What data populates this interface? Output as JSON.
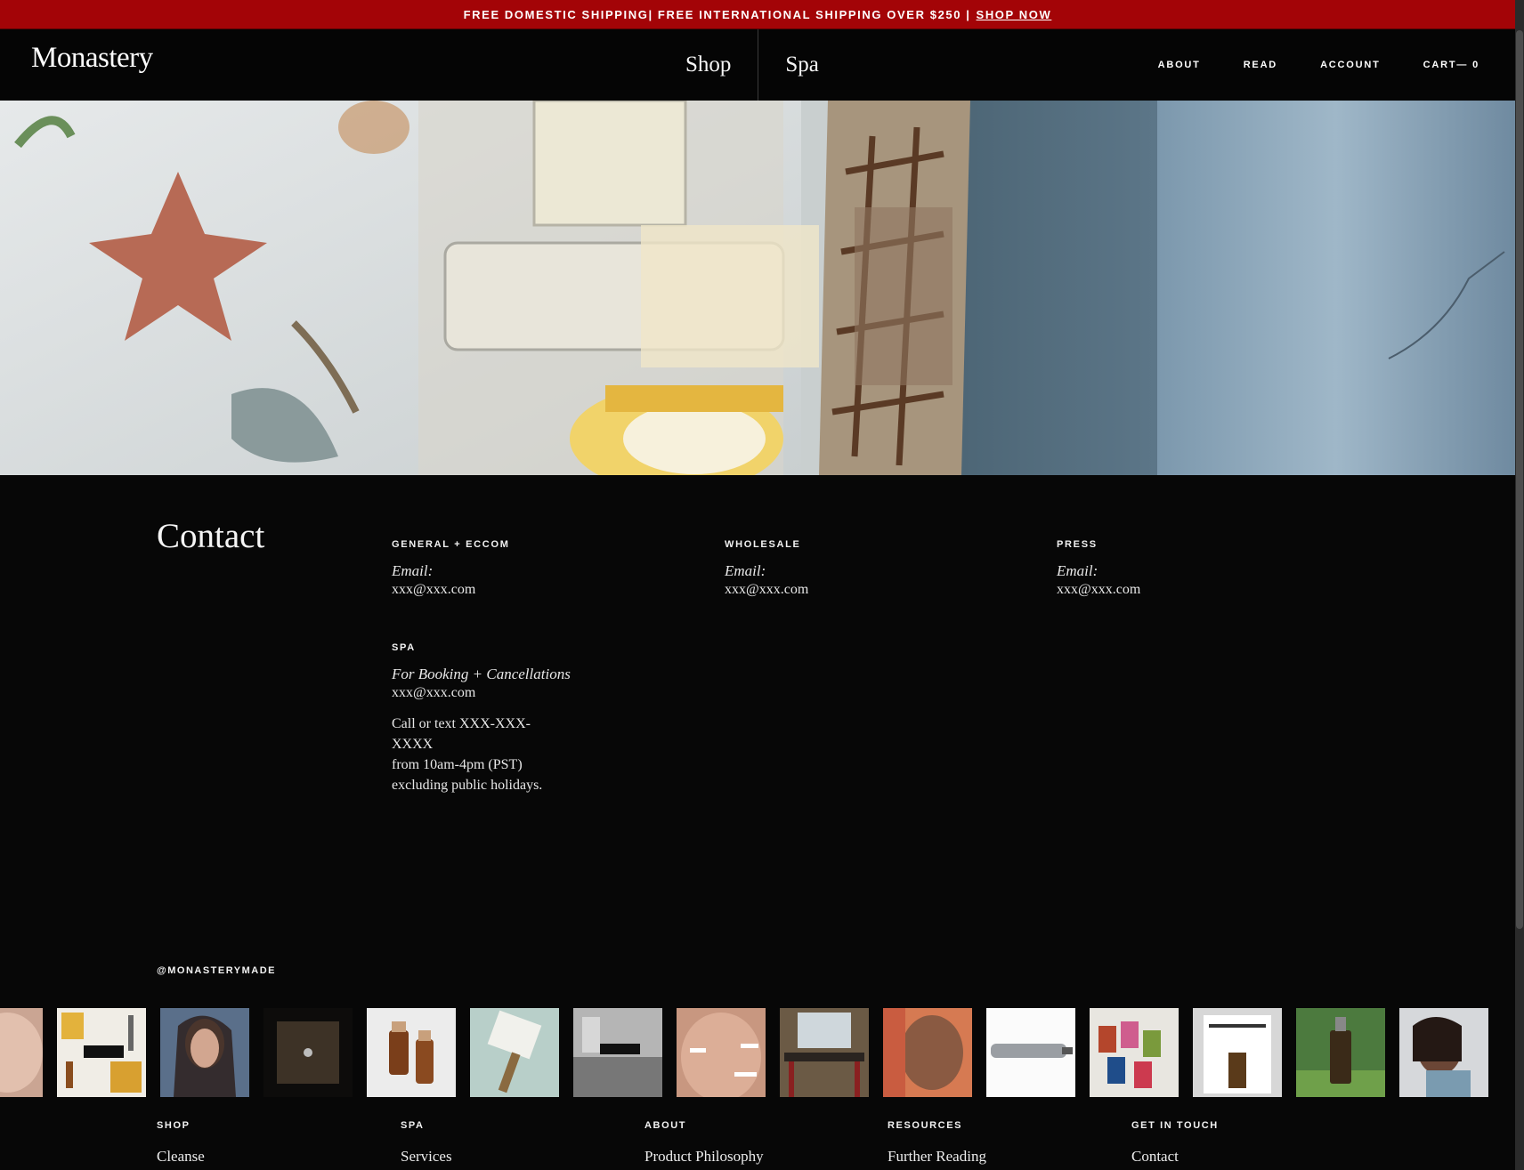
{
  "announcement": {
    "text": "FREE DOMESTIC SHIPPING| FREE INTERNATIONAL SHIPPING OVER $250 |",
    "link": "SHOP NOW"
  },
  "header": {
    "logo": "Monastery",
    "main_nav": [
      "Shop",
      "Spa"
    ],
    "right_nav": {
      "about": "ABOUT",
      "read": "READ",
      "account": "ACCOUNT",
      "cart": "CART— 0"
    }
  },
  "contact": {
    "title": "Contact",
    "general": {
      "label": "GENERAL + ECCOM",
      "email_label": "Email:",
      "email": "xxx@xxx.com"
    },
    "wholesale": {
      "label": "WHOLESALE",
      "email_label": "Email:",
      "email": "xxx@xxx.com"
    },
    "press": {
      "label": "PRESS",
      "email_label": "Email:",
      "email": "xxx@xxx.com"
    },
    "spa": {
      "label": "SPA",
      "booking_label": "For Booking + Cancellations",
      "email": "xxx@xxx.com",
      "hours_line1": "Call or text XXX-XXX-XXXX",
      "hours_line2": "from 10am-4pm (PST)",
      "hours_line3": "excluding public holidays."
    }
  },
  "instagram": {
    "handle": "@MONASTERYMADE"
  },
  "footer": {
    "columns": [
      {
        "heading": "SHOP",
        "first_link": "Cleanse"
      },
      {
        "heading": "SPA",
        "first_link": "Services"
      },
      {
        "heading": "ABOUT",
        "first_link": "Product Philosophy"
      },
      {
        "heading": "RESOURCES",
        "first_link": "Further Reading"
      },
      {
        "heading": "GET IN TOUCH",
        "first_link": "Contact"
      }
    ]
  },
  "colors": {
    "announcement_bg": "#a30407",
    "page_bg": "#070707"
  }
}
